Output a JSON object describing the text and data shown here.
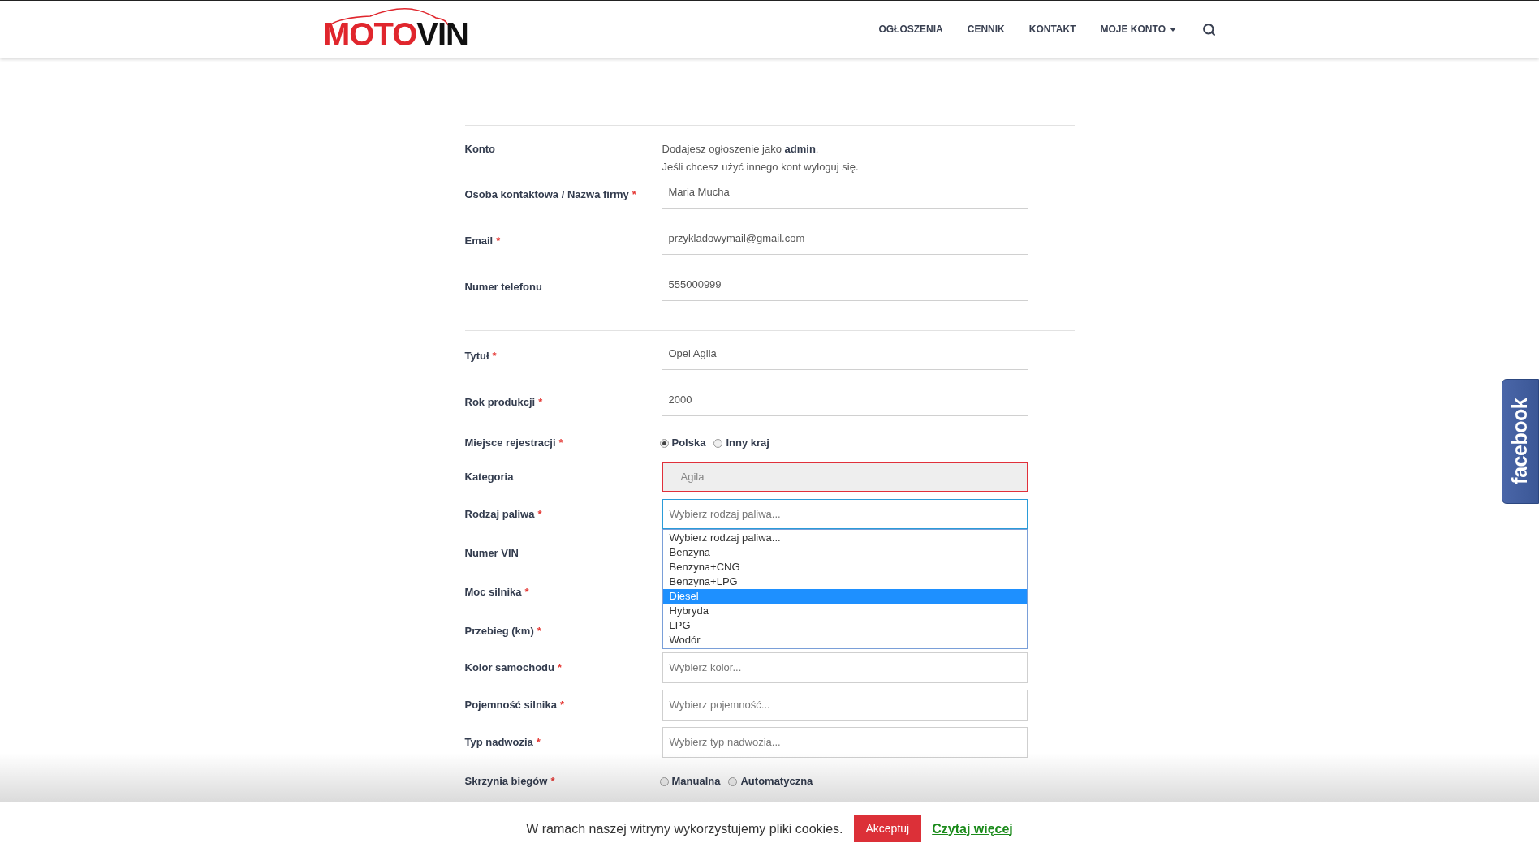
{
  "header": {
    "logo": {
      "part_1": "MOTO",
      "part_2": "VIN"
    },
    "nav": [
      {
        "label": "OGŁOSZENIA",
        "kind": "link"
      },
      {
        "label": "CENNIK",
        "kind": "link"
      },
      {
        "label": "KONTAKT",
        "kind": "link"
      },
      {
        "label": "MOJE KONTO",
        "kind": "dropdown"
      }
    ]
  },
  "account": {
    "label": "Konto",
    "line_1": "Dodajesz ogłoszenie jako **admin**.",
    "line_2": "Jeśli chcesz użyć innego kont wyloguj się."
  },
  "contact_fields": [
    {
      "kind": "text",
      "label": "Osoba kontaktowa / Nazwa firmy",
      "required_mark": "*",
      "value": "Maria Mucha"
    },
    {
      "kind": "text",
      "label": "Email",
      "required_mark": "*",
      "value": "przykladowymail@gmail.com"
    },
    {
      "kind": "text",
      "label": "Numer telefonu",
      "value": "555000999"
    }
  ],
  "vehicle_fields": [
    {
      "kind": "text",
      "label": "Tytuł",
      "required_mark": "*",
      "value": "Opel Agila"
    },
    {
      "kind": "text",
      "label": "Rok produkcji",
      "required_mark": "*",
      "value": "2000"
    },
    {
      "kind": "radio",
      "label": "Miejsce rejestracji",
      "required_mark": "*",
      "options": [
        {
          "label": "Polska",
          "selected": true
        },
        {
          "label": "Inny kraj",
          "selected": false
        }
      ]
    },
    {
      "kind": "readonly",
      "label": "Kategoria",
      "value": "Agila"
    },
    {
      "kind": "open_select",
      "label": "Rodzaj paliwa",
      "required_mark": "*",
      "placeholder": "Wybierz rodzaj paliwa...",
      "options": [
        {
          "label": "Wybierz rodzaj paliwa...",
          "selected": false
        },
        {
          "label": "Benzyna",
          "selected": false
        },
        {
          "label": "Benzyna+CNG",
          "selected": false
        },
        {
          "label": "Benzyna+LPG",
          "selected": false
        },
        {
          "label": "Diesel",
          "selected": true
        },
        {
          "label": "Hybryda",
          "selected": false
        },
        {
          "label": "LPG",
          "selected": false
        },
        {
          "label": "Wodór",
          "selected": false
        }
      ]
    },
    {
      "kind": "covered",
      "label": "Numer VIN"
    },
    {
      "kind": "covered",
      "label": "Moc silnika",
      "required_mark": "*"
    },
    {
      "kind": "covered",
      "label": "Przebieg (km)",
      "required_mark": "*"
    },
    {
      "kind": "select",
      "label": "Kolor samochodu",
      "required_mark": "*",
      "placeholder": "Wybierz kolor..."
    },
    {
      "kind": "select",
      "label": "Pojemność silnika",
      "required_mark": "*",
      "placeholder": "Wybierz pojemność..."
    },
    {
      "kind": "select",
      "label": "Typ nadwozia",
      "required_mark": "*",
      "placeholder": "Wybierz typ nadwozia..."
    },
    {
      "kind": "radio",
      "label": "Skrzynia biegów",
      "required_mark": "*",
      "options": [
        {
          "label": "Manualna",
          "selected": false
        },
        {
          "label": "Automatyczna",
          "selected": false
        }
      ]
    }
  ],
  "facebook_tab": {
    "label": "facebook"
  },
  "cookie_bar": {
    "text": "W ramach naszej witryny wykorzystujemy pliki cookies.",
    "button": "Akceptuj",
    "link": "Czytaj więcej"
  }
}
